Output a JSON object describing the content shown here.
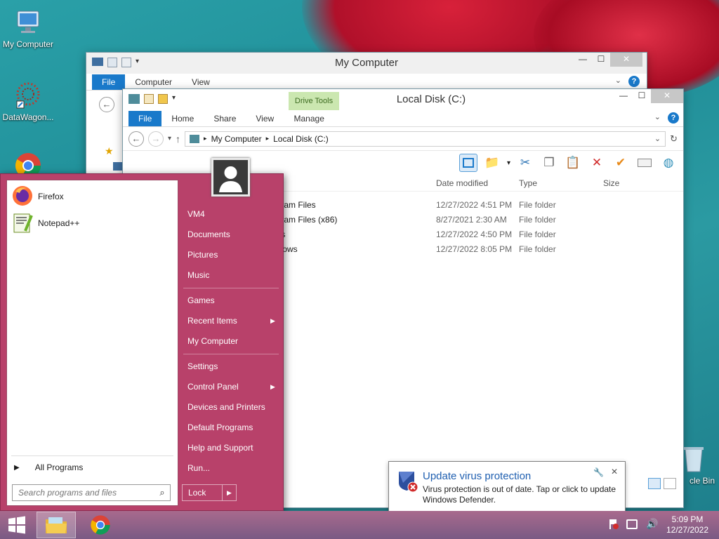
{
  "desktop_icons": [
    {
      "label": "My Computer",
      "icon": "computer-icon"
    },
    {
      "label": "DataWagon...",
      "icon": "datawagon-icon"
    },
    {
      "label": "",
      "icon": "chrome-icon"
    },
    {
      "label": "cle Bin",
      "icon": "recycle-bin-icon"
    }
  ],
  "my_computer_window": {
    "title": "My Computer",
    "tabs": [
      "File",
      "Computer",
      "View"
    ]
  },
  "local_disk_window": {
    "title": "Local Disk (C:)",
    "drive_tools_label": "Drive Tools",
    "tabs": [
      "File",
      "Home",
      "Share",
      "View",
      "Manage"
    ],
    "breadcrumb": [
      "My Computer",
      "Local Disk (C:)"
    ],
    "columns": [
      "Date modified",
      "Type",
      "Size"
    ],
    "files": [
      {
        "name": "Program Files",
        "date": "12/27/2022 4:51 PM",
        "type": "File folder"
      },
      {
        "name": "Program Files (x86)",
        "date": "8/27/2021 2:30 AM",
        "type": "File folder"
      },
      {
        "name": "Users",
        "date": "12/27/2022 4:50 PM",
        "type": "File folder"
      },
      {
        "name": "Windows",
        "date": "12/27/2022 8:05 PM",
        "type": "File folder"
      }
    ]
  },
  "start_menu": {
    "programs": [
      {
        "label": "Firefox",
        "icon": "firefox-icon"
      },
      {
        "label": "Notepad++",
        "icon": "notepadpp-icon"
      }
    ],
    "all_programs": "All Programs",
    "search_placeholder": "Search programs and files",
    "right_items": [
      "VM4",
      "Documents",
      "Pictures",
      "Music",
      "Games",
      "Recent Items",
      "My Computer",
      "Settings",
      "Control Panel",
      "Devices and Printers",
      "Default Programs",
      "Help and Support",
      "Run..."
    ],
    "lock_label": "Lock"
  },
  "notification": {
    "title": "Update virus protection",
    "body": "Virus protection is out of date. Tap or click to update Windows Defender."
  },
  "taskbar": {
    "time": "5:09 PM",
    "date": "12/27/2022"
  },
  "colors": {
    "start_menu": "#b8416a",
    "file_tab": "#1979ca",
    "notify_title": "#1f5fb0"
  }
}
